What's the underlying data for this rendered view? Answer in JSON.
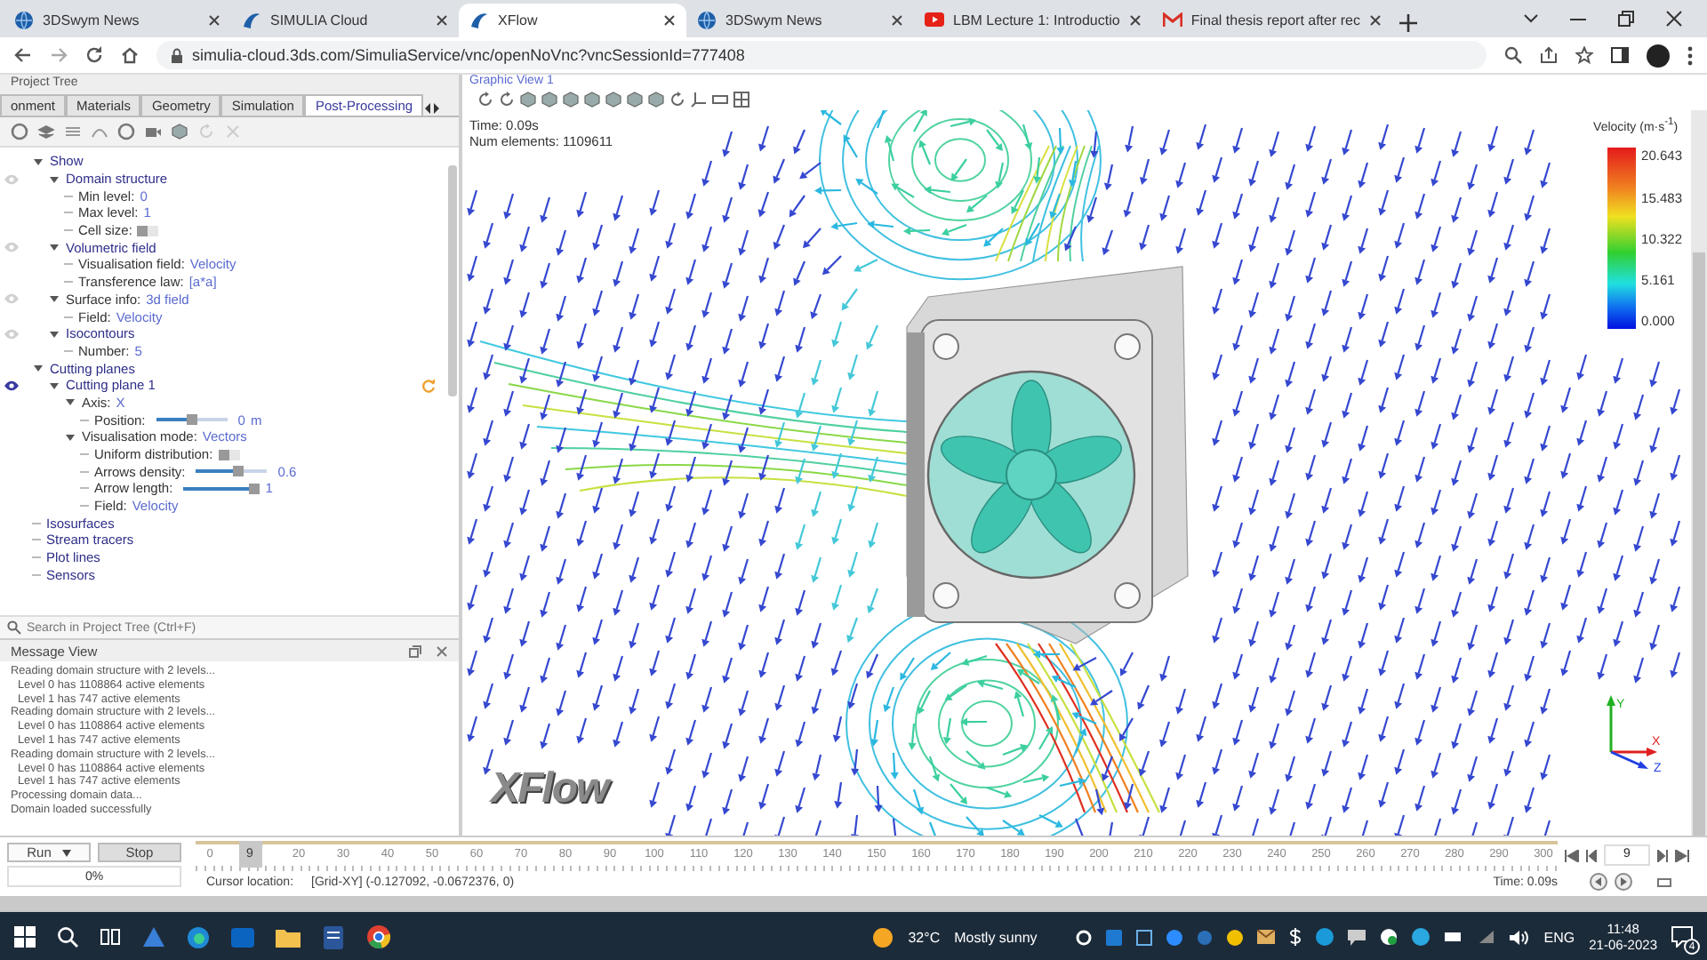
{
  "browser": {
    "tabs": [
      {
        "title": "3DSwym News",
        "kind": "globe",
        "selected": false
      },
      {
        "title": "SIMULIA Cloud",
        "kind": "ds",
        "selected": false
      },
      {
        "title": "XFlow",
        "kind": "ds",
        "selected": true
      },
      {
        "title": "3DSwym News",
        "kind": "globe",
        "selected": false
      },
      {
        "title": "LBM Lecture 1: Introductio",
        "kind": "video",
        "selected": false
      },
      {
        "title": "Final thesis report after rec",
        "kind": "mail",
        "selected": false
      }
    ],
    "url": "simulia-cloud.3ds.com/SimuliaService/vnc/openNoVnc?vncSessionId=777408"
  },
  "left_panel": {
    "title": "Project Tree",
    "tabs": [
      {
        "label": "onment",
        "selected": false
      },
      {
        "label": "Materials",
        "selected": false
      },
      {
        "label": "Geometry",
        "selected": false
      },
      {
        "label": "Simulation",
        "selected": false
      },
      {
        "label": "Post-Processing",
        "selected": true
      }
    ],
    "tree": [
      {
        "label": "Show",
        "kind": "group",
        "expanded": true,
        "children": [
          {
            "label": "Domain structure",
            "kind": "group",
            "expanded": true,
            "visible": false,
            "children": [
              {
                "label": "Min level:",
                "kind": "value",
                "value": "0"
              },
              {
                "label": "Max level:",
                "kind": "value",
                "value": "1"
              },
              {
                "label": "Cell size:",
                "kind": "toggle",
                "on": false
              }
            ]
          },
          {
            "label": "Volumetric field",
            "kind": "group",
            "expanded": true,
            "visible": false,
            "children": [
              {
                "label": "Visualisation field:",
                "kind": "value",
                "value": "Velocity"
              },
              {
                "label": "Transference law:",
                "kind": "value",
                "value": "[a*a]"
              }
            ]
          },
          {
            "label": "Surface info:",
            "kind": "value",
            "value": "3d field",
            "expanded": true,
            "visible": false,
            "children": [
              {
                "label": "Field:",
                "kind": "value",
                "value": "Velocity"
              }
            ]
          },
          {
            "label": "Isocontours",
            "kind": "group",
            "expanded": true,
            "visible": false,
            "children": [
              {
                "label": "Number:",
                "kind": "value",
                "value": "5"
              }
            ]
          }
        ]
      },
      {
        "label": "Cutting planes",
        "kind": "group",
        "expanded": true,
        "children": [
          {
            "label": "Cutting plane 1",
            "kind": "group",
            "expanded": true,
            "visible": true,
            "updating": true,
            "children": [
              {
                "label": "Axis:",
                "kind": "value",
                "value": "X",
                "expanded": true,
                "children": [
                  {
                    "label": "Position:",
                    "kind": "slider",
                    "level": 0.5,
                    "value": "0",
                    "unit": "m"
                  }
                ]
              },
              {
                "label": "Visualisation mode:",
                "kind": "value",
                "value": "Vectors",
                "expanded": true,
                "children": [
                  {
                    "label": "Uniform distribution:",
                    "kind": "toggle",
                    "on": false
                  },
                  {
                    "label": "Arrows density:",
                    "kind": "slider",
                    "level": 0.6,
                    "value": "0.6"
                  },
                  {
                    "label": "Arrow length:",
                    "kind": "slider",
                    "level": 1,
                    "value": "1"
                  },
                  {
                    "label": "Field:",
                    "kind": "value",
                    "value": "Velocity"
                  }
                ]
              }
            ]
          }
        ]
      },
      {
        "label": "Isosurfaces",
        "kind": "group"
      },
      {
        "label": "Stream tracers",
        "kind": "group"
      },
      {
        "label": "Plot lines",
        "kind": "group"
      },
      {
        "label": "Sensors",
        "kind": "group"
      }
    ],
    "search": {
      "placeholder": "Search in Project Tree (Ctrl+F)"
    }
  },
  "message_view": {
    "title": "Message View",
    "messages": [
      {
        "text": "Reading domain structure with 2 levels...",
        "kind": "main"
      },
      {
        "text": "Level 0 has 1108864 active elements",
        "kind": "sub"
      },
      {
        "text": "Level 1 has 747 active elements",
        "kind": "sub"
      },
      {
        "text": "Reading domain structure with 2 levels...",
        "kind": "main"
      },
      {
        "text": "Level 0 has 1108864 active elements",
        "kind": "sub"
      },
      {
        "text": "Level 1 has 747 active elements",
        "kind": "sub"
      },
      {
        "text": "Reading domain structure with 2 levels...",
        "kind": "main"
      },
      {
        "text": "Level 0 has 1108864 active elements",
        "kind": "sub"
      },
      {
        "text": "Level 1 has 747 active elements",
        "kind": "sub"
      },
      {
        "text": "Processing domain data...",
        "kind": "main"
      },
      {
        "text": "Domain loaded successfully",
        "kind": "main"
      }
    ]
  },
  "graphic_view": {
    "title": "Graphic View 1",
    "time": "Time: 0.09s",
    "elements": "Num elements: 1109611",
    "legend": {
      "title": "Velocity (m·s$^{-1}$)",
      "labels": [
        "20.643",
        "15.483",
        "10.322",
        "5.161",
        "0.000"
      ]
    },
    "axes": {
      "x": "X",
      "y": "Y",
      "z": "Z"
    },
    "logo": "XFlow"
  },
  "run_controls": {
    "run": "Run",
    "stop": "Stop",
    "progress": "0%",
    "level": 0
  },
  "timeline": {
    "ticks": [
      "0",
      "20",
      "30",
      "40",
      "50",
      "60",
      "70",
      "80",
      "90",
      "100",
      "110",
      "120",
      "130",
      "140",
      "150",
      "160",
      "170",
      "180",
      "190",
      "200",
      "210",
      "220",
      "230",
      "240",
      "250",
      "260",
      "270",
      "280",
      "290",
      "300"
    ],
    "current": "9",
    "level": 0.03,
    "frame": "9",
    "cursor_label": "Cursor location:",
    "cursor_value": "[Grid-XY] (-0.127092, -0.0672376, 0)",
    "time": "Time: 0.09s"
  },
  "taskbar": {
    "temperature": "32°C",
    "weather": "Mostly sunny",
    "language": "ENG",
    "time": "11:48",
    "date": "21-06-2023",
    "notifications": "4"
  }
}
